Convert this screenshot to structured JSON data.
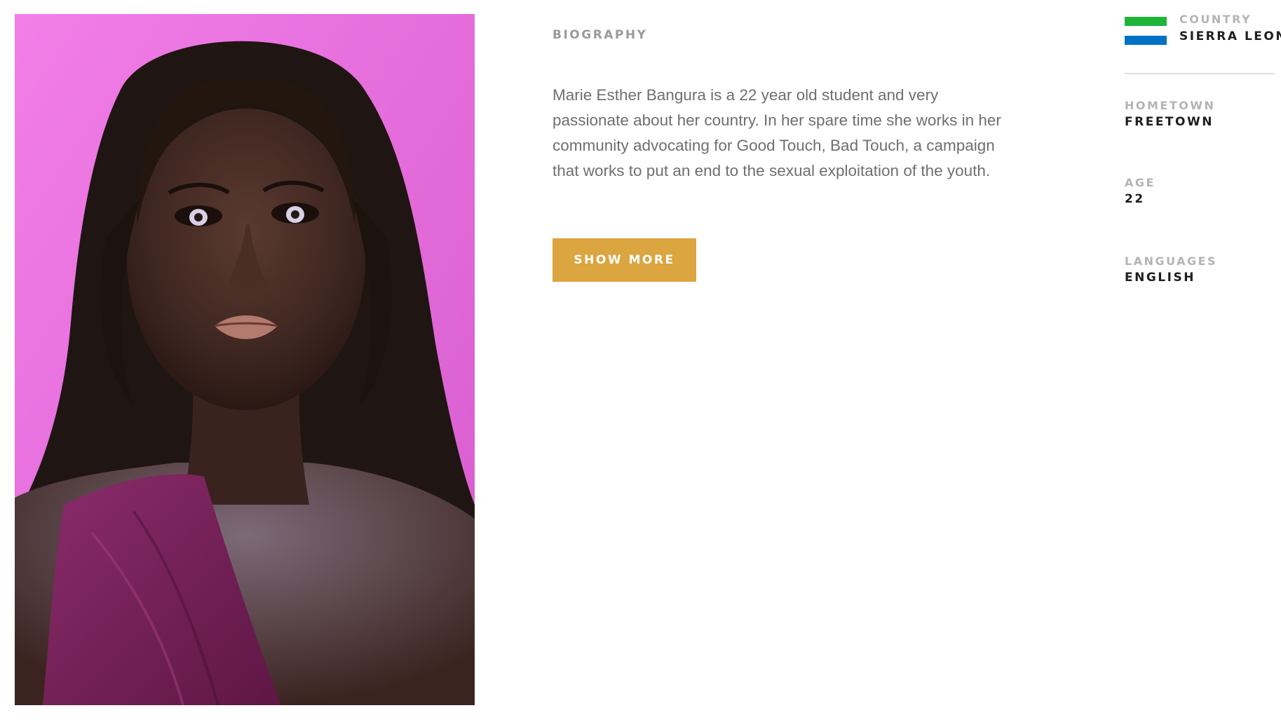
{
  "profile": {
    "photo_alt": "Marie Esther Bangura portrait"
  },
  "biography": {
    "heading": "BIOGRAPHY",
    "text": "Marie Esther Bangura is a 22 year old student and very passionate about her country. In her spare time she works in her community advocating for Good Touch, Bad Touch, a campaign that works to put an end to the sexual exploitation of the youth.",
    "button_label": "SHOW MORE"
  },
  "facts": {
    "country": {
      "label": "COUNTRY",
      "value": "SIERRA LEONE",
      "flag_icon": "sierra-leone-flag-icon",
      "flag_colors": [
        "#1eb53a",
        "#ffffff",
        "#0072c6"
      ]
    },
    "hometown": {
      "label": "HOMETOWN",
      "value": "FREETOWN"
    },
    "age": {
      "label": "AGE",
      "value": "22"
    },
    "languages": {
      "label": "LANGUAGES",
      "value": "ENGLISH"
    }
  },
  "colors": {
    "accent": "#dba53f",
    "label_gray": "#b4b4b4",
    "body_text": "#6f6f6f",
    "photo_background": "#ec70e2"
  }
}
